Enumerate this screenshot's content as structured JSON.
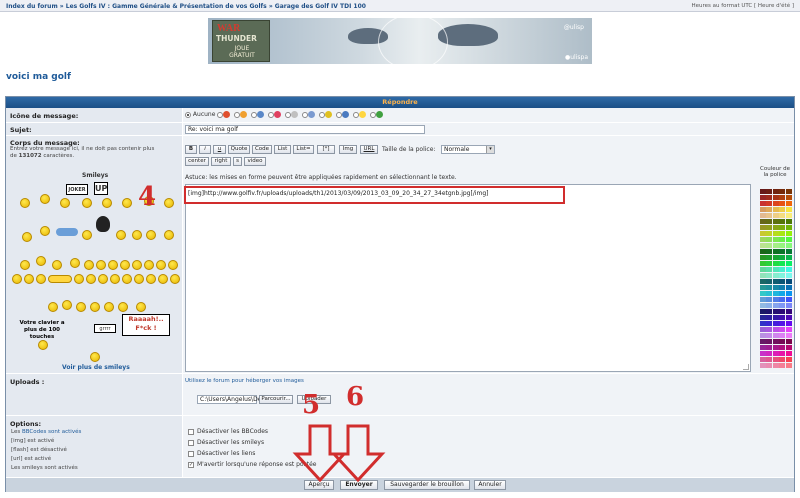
{
  "breadcrumb": "Index du forum » Les Golfs IV : Gamme Générale & Présentation de vos Golfs » Garage des Golf IV TDI 100",
  "timezone": "Heures au format UTC [ Heure d'été ]",
  "banner": {
    "game_word1": "WAR",
    "game_word2": "THUNDER",
    "cta": "JOUE GRATUIT",
    "brand1": "@ulisp",
    "brand2": "●ulispa"
  },
  "topic_title": "voici ma golf",
  "form": {
    "header": "Répondre",
    "message_icon_label": "Icône de message:",
    "message_icon_none": "Aucune",
    "subject_label": "Sujet:",
    "subject_value": "Re: voici ma golf",
    "body_label": "Corps du message:",
    "body_sub": "Entrez votre message ici, il ne doit pas contenir plus de",
    "body_limit": "131072",
    "body_limit_suffix": "caractères.",
    "smileys_title": "Smileys",
    "more_smileys": "Voir plus de smileys",
    "tip": "Astuce: les mises en forme peuvent être appliquées rapidement en sélectionnant le texte.",
    "message_text": "[img]http://www.golfiv.fr/uploads/uploads/th1/2013/03/09/2013_03_09_20_34_27_34etgnb.jpg[/img]",
    "font_size_label": "Taille de la police:",
    "font_size_value": "Normale",
    "color_label": "Couleur de la police",
    "bbcode_buttons": [
      "B",
      "i",
      "u",
      "Quote",
      "Code",
      "List",
      "List=",
      "[*]",
      "Img",
      "URL"
    ],
    "bbcode_buttons_row2": [
      "center",
      "right",
      "s",
      "video"
    ],
    "smiley_banner1": "Votre clavier a plus de 100 touches",
    "smiley_banner2": "Raaaah!..",
    "smiley_banner2b": "F*ck !",
    "joker_sign": "JOKER",
    "up_sign": "UP",
    "grrr": "grrrr",
    "uploads_label": "Uploads :",
    "uploads_link": "Utilisez le forum pour héberger vos images",
    "upload_path": "C:\\Users\\Angelus\\Des",
    "browse_button": "Parcourir...",
    "upload_button": "Uploader",
    "options_label": "Options:",
    "options_left": [
      "BBCodes sont activés",
      "[img] est activé",
      "[flash] est désactivé",
      "[url] est activé",
      "Les smileys sont activés"
    ],
    "options_left_bbcodes_prefix": "Les",
    "options": [
      "Désactiver les BBCodes",
      "Désactiver les smileys",
      "Désactiver les liens",
      "M'avertir lorsqu'une réponse est postée"
    ],
    "buttons": {
      "preview": "Aperçu",
      "send": "Envoyer",
      "draft": "Sauvegarder le brouillon",
      "cancel": "Annuler"
    }
  },
  "annotations": [
    "4",
    "5",
    "6"
  ],
  "colors": {
    "accent": "#1b4f86",
    "highlight": "#d12d2d",
    "header_text": "#ffb34a"
  }
}
